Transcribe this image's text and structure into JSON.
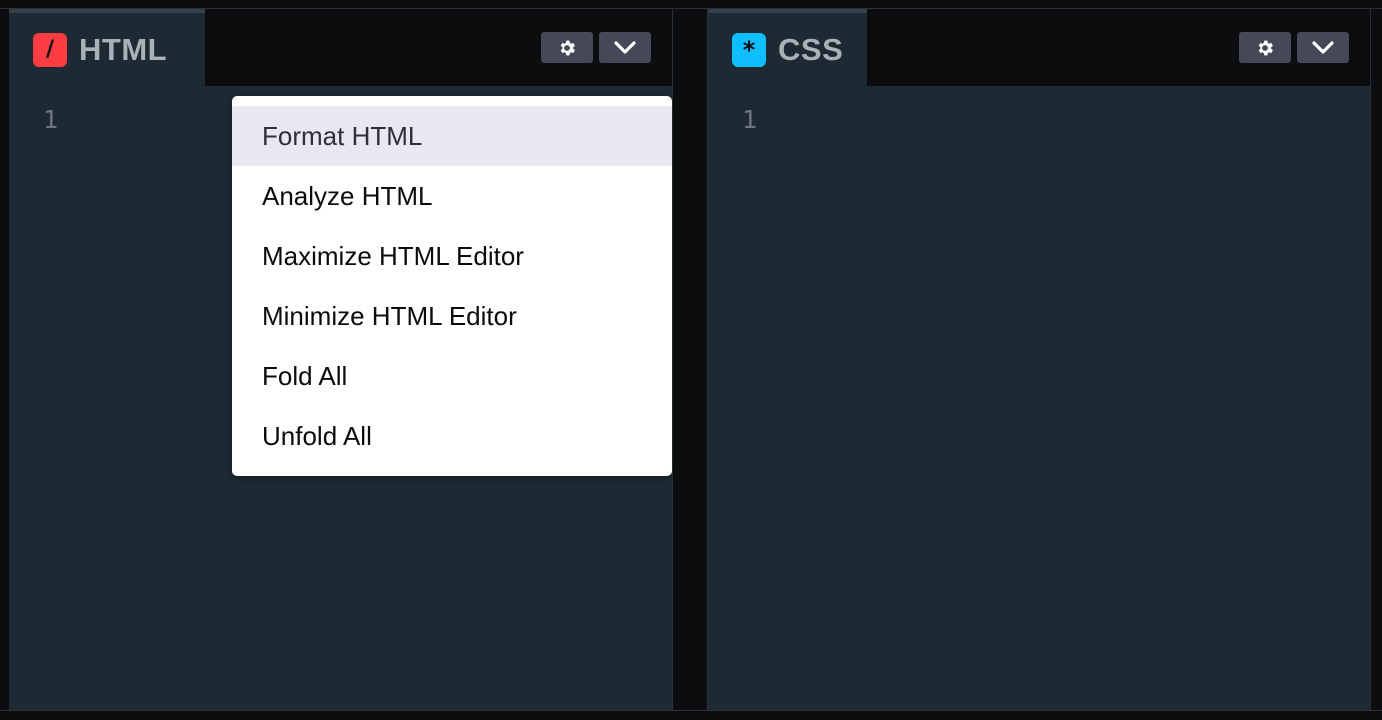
{
  "html_panel": {
    "tab_label": "HTML",
    "icon_glyph": "/",
    "icon_color": "#ff3c41",
    "line_number": "1",
    "settings_icon": "gear-icon",
    "menu_toggle_icon": "chevron-down-icon"
  },
  "css_panel": {
    "tab_label": "CSS",
    "icon_glyph": "*",
    "icon_color": "#0ebeff",
    "line_number": "1",
    "settings_icon": "gear-icon",
    "menu_toggle_icon": "chevron-down-icon"
  },
  "dropdown_menu": {
    "items": [
      {
        "label": "Format HTML",
        "highlighted": true
      },
      {
        "label": "Analyze HTML"
      },
      {
        "label": "Maximize HTML Editor"
      },
      {
        "label": "Minimize HTML Editor"
      },
      {
        "label": "Fold All"
      },
      {
        "label": "Unfold All"
      }
    ]
  },
  "colors": {
    "editor_bg": "#1d2a33",
    "chrome_bg": "#0c0d0f",
    "button_bg": "#444857",
    "menu_highlight": "#e8e8f2"
  }
}
